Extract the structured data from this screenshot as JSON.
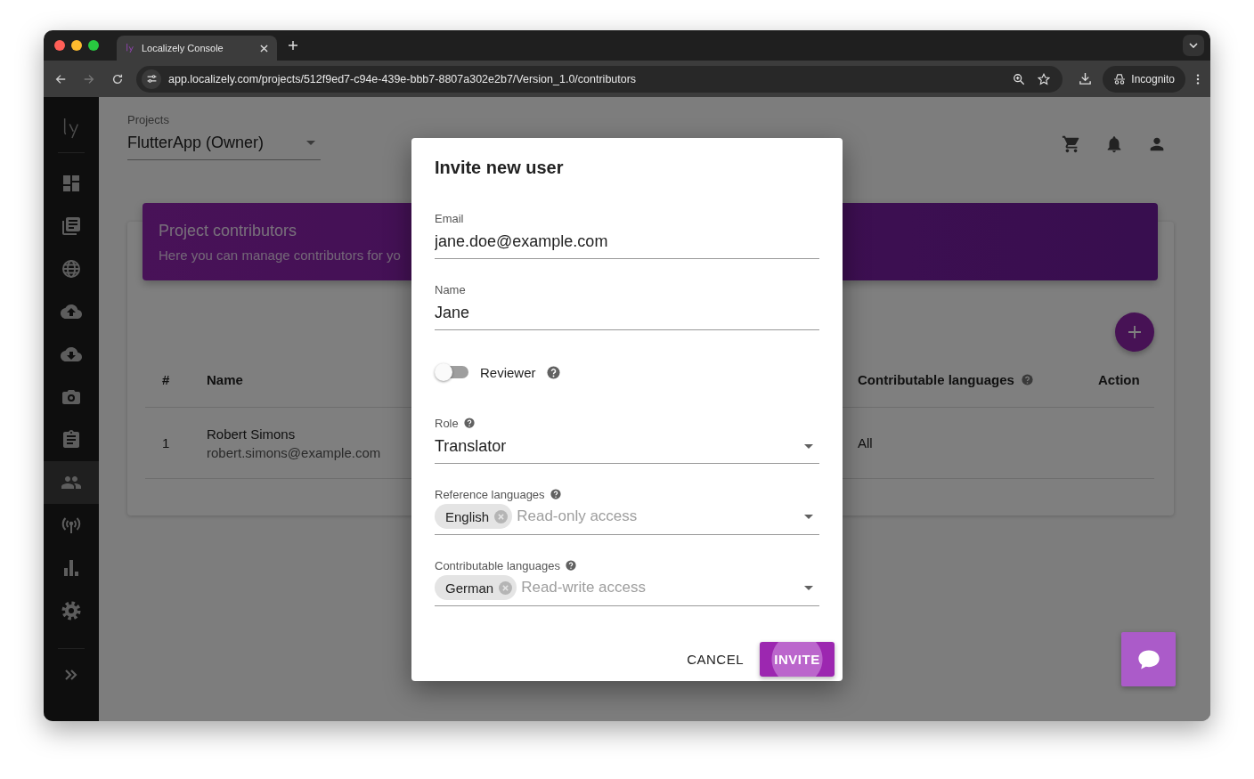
{
  "browser": {
    "tab_title": "Localizely Console",
    "url": "app.localizely.com/projects/512f9ed7-c94e-439e-bbb7-8807a302e2b7/Version_1.0/contributors",
    "incognito_label": "Incognito"
  },
  "sidebar": {
    "items": [
      {
        "selected": false
      },
      {
        "selected": false
      },
      {
        "selected": false
      },
      {
        "selected": false
      },
      {
        "selected": false
      },
      {
        "selected": false
      },
      {
        "selected": false
      },
      {
        "selected": true
      },
      {
        "selected": false
      },
      {
        "selected": false
      },
      {
        "selected": false
      }
    ]
  },
  "header": {
    "projects_label": "Projects",
    "project": "FlutterApp (Owner)"
  },
  "banner": {
    "title": "Project contributors",
    "subtitle": "Here you can manage contributors for yo"
  },
  "table": {
    "columns": [
      {
        "label": "#",
        "help": false
      },
      {
        "label": "Name",
        "help": false
      },
      {
        "label": "Contributable languages",
        "help": true
      },
      {
        "label": "Action",
        "help": false
      }
    ],
    "rows": [
      {
        "number": "1",
        "name": "Robert Simons",
        "email": "robert.simons@example.com",
        "languages": "All"
      }
    ]
  },
  "dialog": {
    "title": "Invite new user",
    "fields": [
      {
        "kind": "text",
        "label": "Email",
        "value": "jane.doe@example.com",
        "help": false
      },
      {
        "kind": "text",
        "label": "Name",
        "value": "Jane",
        "help": false
      },
      {
        "kind": "toggle",
        "label": "Reviewer",
        "on": false,
        "help": true
      },
      {
        "kind": "select",
        "label": "Role",
        "value": "Translator",
        "help": true
      },
      {
        "kind": "chips",
        "label": "Reference languages",
        "chips": [
          "English"
        ],
        "placeholder": "Read-only access",
        "help": true
      },
      {
        "kind": "chips",
        "label": "Contributable languages",
        "chips": [
          "German"
        ],
        "placeholder": "Read-write access",
        "help": true
      }
    ],
    "buttons": [
      {
        "kind": "text",
        "label": "CANCEL"
      },
      {
        "kind": "primary",
        "label": "INVITE"
      }
    ]
  }
}
